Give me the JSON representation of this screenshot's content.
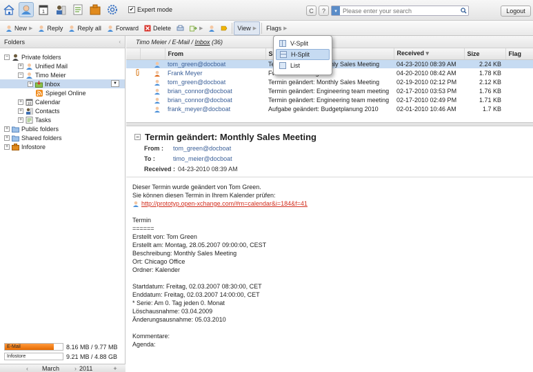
{
  "topbar": {
    "expert_mode_label": "Expert mode",
    "expert_mode_checked": true,
    "refresh_symbol": "C",
    "help_symbol": "?",
    "search_placeholder": "Please enter your search",
    "logout_label": "Logout",
    "app_icons": [
      "home-icon",
      "mail-icon",
      "calendar-icon",
      "contacts-icon",
      "tasks-icon",
      "infostore-icon",
      "settings-icon"
    ]
  },
  "toolbar": {
    "new_label": "New",
    "reply_label": "Reply",
    "reply_all_label": "Reply all",
    "forward_label": "Forward",
    "delete_label": "Delete",
    "view_label": "View",
    "flags_label": "Flags"
  },
  "view_menu": {
    "items": [
      "V-Split",
      "H-Split",
      "List"
    ],
    "highlighted": "H-Split"
  },
  "sidebar": {
    "header": "Folders",
    "tree": {
      "private": "Private folders",
      "unified": "Unified Mail",
      "user": "Timo Meier",
      "inbox": "Inbox",
      "spiegel": "Spiegel Online",
      "calendar": "Calendar",
      "contacts": "Contacts",
      "tasks": "Tasks",
      "public": "Public folders",
      "shared": "Shared folders",
      "infostore": "Infostore"
    },
    "quota": {
      "email_label": "E-Mail",
      "email_value": "8.16 MB / 9.77 MB",
      "email_fraction": 0.84,
      "infostore_label": "Infostore",
      "infostore_value": "9.21 MB / 4.88 GB",
      "infostore_fraction": 0.002
    },
    "minical": {
      "prev": "‹",
      "month": "March",
      "next": "›",
      "year": "2011",
      "plus": "+"
    }
  },
  "breadcrumb": {
    "user": "Timo Meier",
    "sep1": " / ",
    "module": "E-Mail",
    "sep2": " / ",
    "folder": "Inbox",
    "count": " (36)"
  },
  "mail_list": {
    "columns": {
      "from": "From",
      "subject": "Subject",
      "received": "Received",
      "size": "Size",
      "flag": "Flag"
    },
    "rows": [
      {
        "from": "tom_green@docboat",
        "subject": "Termin geändert: Monthly Sales Meeting",
        "received": "04-23-2010 08:39 AM",
        "size": "2.24 KB"
      },
      {
        "from": "Frank Meyer",
        "subject": "Fw: Urlaubsantrag",
        "received": "04-20-2010 08:42 AM",
        "size": "1.78 KB"
      },
      {
        "from": "tom_green@docboat",
        "subject": "Termin geändert: Monthly Sales Meeting",
        "received": "02-19-2010 02:12 PM",
        "size": "2.12 KB"
      },
      {
        "from": "brian_connor@docboat",
        "subject": "Termin geändert: Engineering team meeting",
        "received": "02-17-2010 03:53 PM",
        "size": "1.76 KB"
      },
      {
        "from": "brian_connor@docboat",
        "subject": "Termin geändert: Engineering team meeting",
        "received": "02-17-2010 02:49 PM",
        "size": "1.71 KB"
      },
      {
        "from": "frank_meyer@docboat",
        "subject": "Aufgabe geändert: Budgetplanung 2010",
        "received": "02-01-2010 10:46 AM",
        "size": "1.7 KB"
      }
    ]
  },
  "preview": {
    "subject": "Termin geändert: Monthly Sales Meeting",
    "from_label": "From :",
    "from": "tom_green@docboat",
    "to_label": "To :",
    "to": "timo_meier@docboat",
    "received_label": "Received :",
    "received": "04-23-2010 08:39 AM",
    "body_top": [
      "Dieser Termin wurde geändert von Tom Green.",
      "Sie können diesen Termin in Ihrem Kalender prüfen:"
    ],
    "link": "http://prototyp.open-xchange.com/#m=calendar&i=184&f=41",
    "body_rest": [
      "",
      "Termin",
      "======",
      "Erstellt von:  Tom Green",
      "Erstellt am: Montag, 28.05.2007 09:00:00, CEST",
      "Beschreibung: Monthly Sales Meeting",
      "Ort: Chicago Office",
      "Ordner: Kalender",
      "",
      "Startdatum: Freitag, 02.03.2007 08:30:00, CET",
      "Enddatum: Freitag, 02.03.2007 14:00:00, CET",
      "* Serie: Am 0. Tag jeden 0. Monat",
      "Löschausnahme: 03.04.2009",
      "Änderungsausnahme: 05.03.2010",
      "",
      "Kommentare:",
      "Agenda:"
    ]
  },
  "colors": {
    "accent": "#3a5f98",
    "selection": "#c6dbf2",
    "link": "#d12a1a",
    "quota": "#e46a00"
  }
}
